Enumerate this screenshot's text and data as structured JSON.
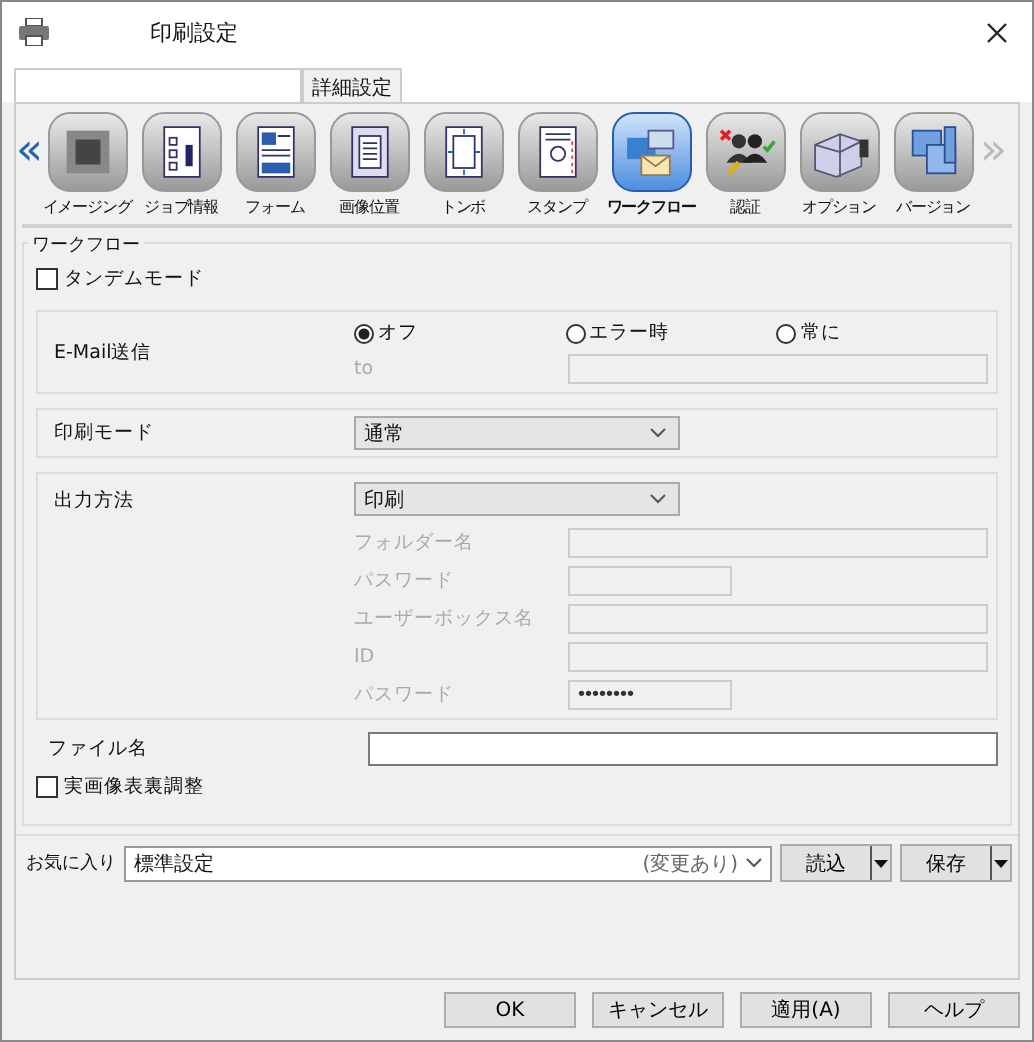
{
  "window": {
    "title": "印刷設定"
  },
  "tabs": [
    {
      "kind": "blank",
      "selected": true
    },
    {
      "kind": "text",
      "label": "詳細設定",
      "selected": false
    }
  ],
  "toolbar": {
    "items": [
      {
        "kind": "imaging",
        "label": "イメージング",
        "selected": false
      },
      {
        "kind": "jobinfo",
        "label": "ジョブ情報",
        "selected": false
      },
      {
        "kind": "form",
        "label": "フォーム",
        "selected": false
      },
      {
        "kind": "position",
        "label": "画像位置",
        "selected": false
      },
      {
        "kind": "trim",
        "label": "トンボ",
        "selected": false
      },
      {
        "kind": "stamp",
        "label": "スタンプ",
        "selected": false
      },
      {
        "kind": "workflow",
        "label": "ワークフロー",
        "selected": true
      },
      {
        "kind": "auth",
        "label": "認証",
        "selected": false
      },
      {
        "kind": "option",
        "label": "オプション",
        "selected": false
      },
      {
        "kind": "version",
        "label": "バージョン",
        "selected": false
      }
    ],
    "prev": "«",
    "next": "»",
    "next_disabled": true
  },
  "group": {
    "title": "ワークフロー",
    "tandem": {
      "label": "タンデムモード",
      "checked": false
    },
    "email": {
      "label": "E-Mail送信",
      "options": [
        {
          "label": "オフ",
          "selected": true
        },
        {
          "label": "エラー時",
          "selected": false
        },
        {
          "label": "常に",
          "selected": false
        }
      ],
      "to_label": "to",
      "to_disabled": true
    },
    "print_mode": {
      "label": "印刷モード",
      "value": "通常"
    },
    "output": {
      "label": "出力方法",
      "value": "印刷",
      "fields": [
        {
          "label": "フォルダー名",
          "kind": "wide",
          "disabled": true
        },
        {
          "label": "パスワード",
          "kind": "short",
          "disabled": true
        },
        {
          "label": "ユーザーボックス名",
          "kind": "wide",
          "disabled": true
        },
        {
          "label": "ID",
          "kind": "wide",
          "disabled": true
        },
        {
          "label": "パスワード",
          "kind": "short",
          "disabled": true,
          "value": "••••••••"
        }
      ]
    },
    "file_name": {
      "label": "ファイル名"
    },
    "adjust": {
      "label": "実画像表裏調整",
      "checked": false
    }
  },
  "favorites": {
    "label": "お気に入り",
    "value": "標準設定",
    "note": "(変更あり)",
    "load": "読込",
    "save": "保存"
  },
  "buttons": [
    "OK",
    "キャンセル",
    "適用(A)",
    "ヘルプ"
  ]
}
